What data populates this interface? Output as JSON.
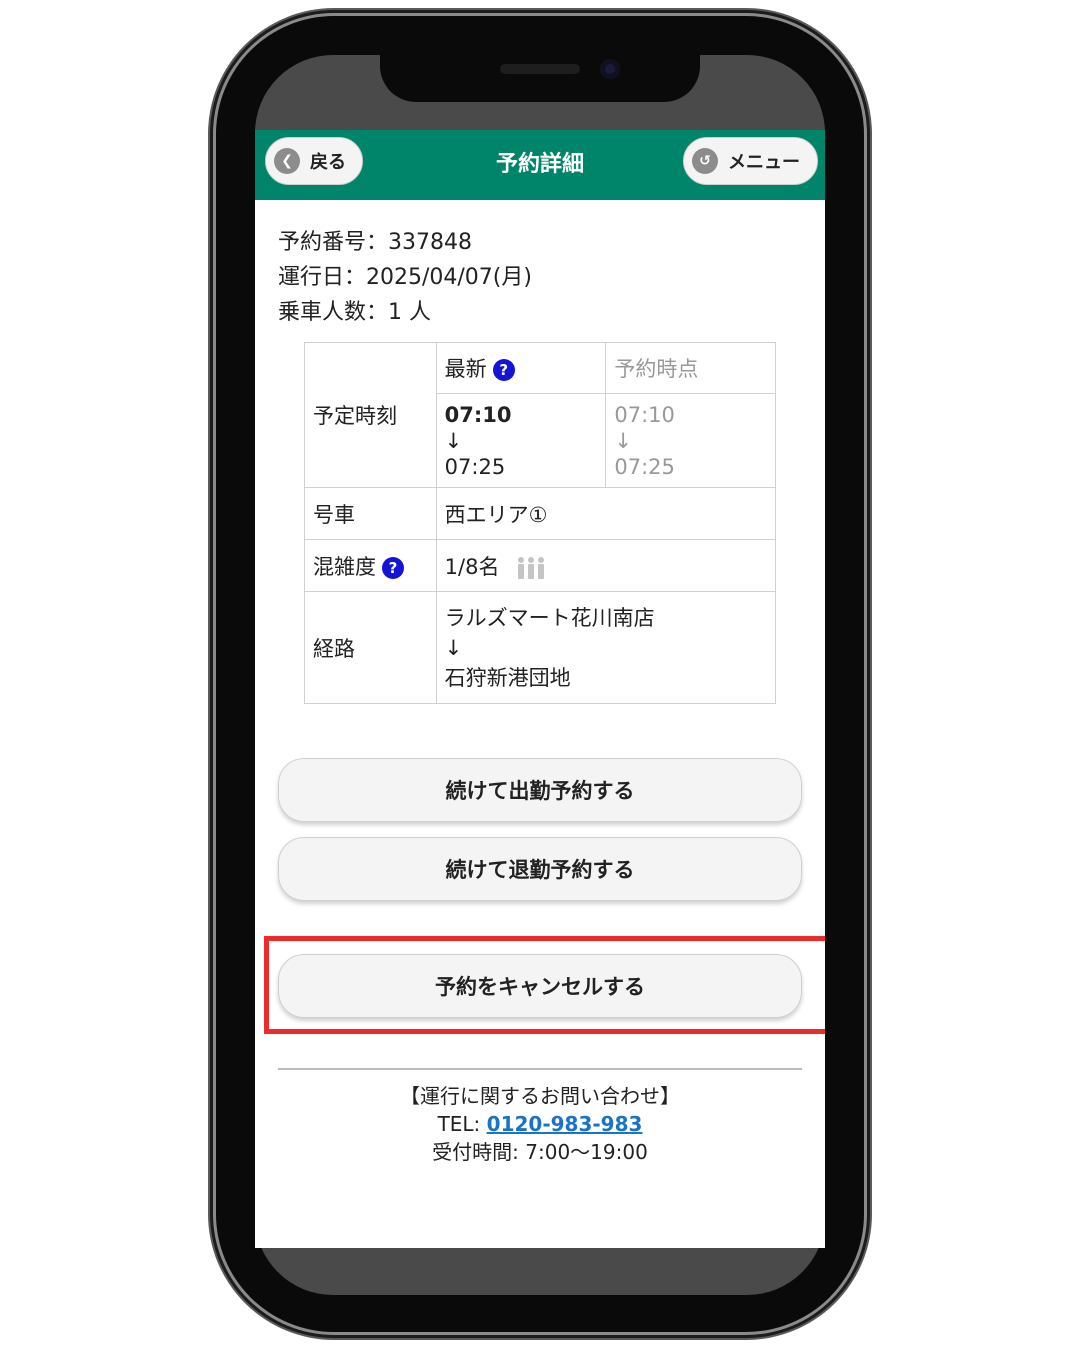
{
  "header": {
    "back_label": "戻る",
    "title": "予約詳細",
    "menu_label": "メニュー"
  },
  "info": {
    "reservation_number": "予約番号：337848",
    "service_date": "運行日：2025/04/07(月)",
    "passengers": "乗車人数：1 人"
  },
  "table": {
    "col_latest": "最新",
    "col_at_booking": "予約時点",
    "scheduled_label": "予定時刻",
    "latest_depart": "07:10",
    "latest_arrive": "07:25",
    "booking_depart": "07:10",
    "booking_arrive": "07:25",
    "arrow": "↓",
    "car_label": "号車",
    "car_value": "西エリア①",
    "crowd_label": "混雑度",
    "crowd_value": "1/8名",
    "route_label": "経路",
    "route_from": "ラルズマート花川南店",
    "route_to": "石狩新港団地"
  },
  "actions": {
    "continue_commute": "続けて出勤予約する",
    "continue_return": "続けて退勤予約する",
    "cancel": "予約をキャンセルする"
  },
  "footer": {
    "heading": "【運行に関するお問い合わせ】",
    "tel_prefix": "TEL: ",
    "tel_number": "0120-983-983",
    "hours": "受付時間: 7:00〜19:00"
  },
  "colors": {
    "header_bg": "#00856a",
    "highlight": "#ee2b2b",
    "help_icon": "#1414d8",
    "link": "#1a73c8"
  }
}
